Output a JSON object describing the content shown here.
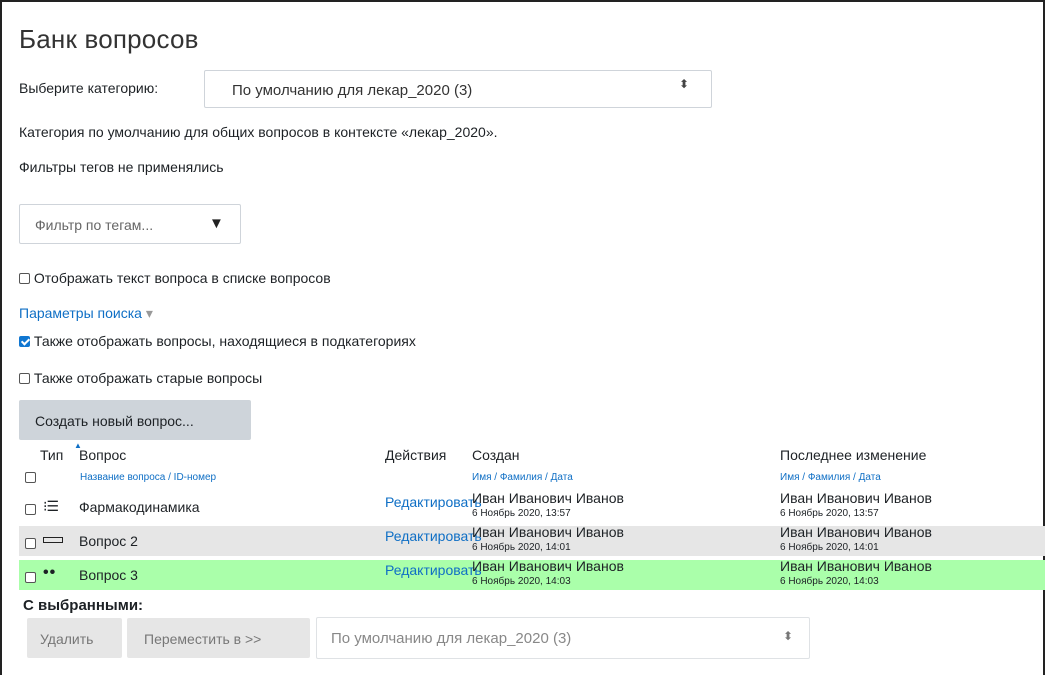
{
  "page_title": "Банк вопросов",
  "category": {
    "label": "Выберите категорию:",
    "selected": "По умолчанию для лекар_2020 (3)",
    "description": "Категория по умолчанию для общих вопросов в контексте «лекар_2020».",
    "arrows": "⬍"
  },
  "tags": {
    "status": "Фильтры тегов не применялись",
    "filter_placeholder": "Фильтр по тегам...",
    "filter_arrow": "▼"
  },
  "options": {
    "show_text": "Отображать текст вопроса в списке вопросов",
    "search_params": "Параметры поиска",
    "search_params_arrow": "▾",
    "subcategories": "Также отображать вопросы, находящиеся в подкатегориях",
    "old_questions": "Также отображать старые вопросы"
  },
  "create_button": "Создать новый вопрос...",
  "table": {
    "col_type": "Тип",
    "col_question": "Вопрос",
    "col_question_sub": "Название вопроса / ID-номер",
    "col_actions": "Действия",
    "col_created": "Создан",
    "col_created_sub": "Имя / Фамилия / Дата",
    "col_modified": "Последнее изменение",
    "col_modified_sub": "Имя / Фамилия / Дата",
    "rows": [
      {
        "type_icon": "multichoice-icon",
        "name": "Фармакодинамика",
        "action": "Редактировать",
        "created_by": "Иван Иванович Иванов",
        "created_at": "6 Ноябрь 2020, 13:57",
        "modified_by": "Иван Иванович Иванов",
        "modified_at": "6 Ноябрь 2020, 13:57"
      },
      {
        "type_icon": "shortanswer-icon",
        "name": "Вопрос 2",
        "action": "Редактировать",
        "created_by": "Иван Иванович Иванов",
        "created_at": "6 Ноябрь 2020, 14:01",
        "modified_by": "Иван Иванович Иванов",
        "modified_at": "6 Ноябрь 2020, 14:01"
      },
      {
        "type_icon": "truefalse-icon",
        "name": "Вопрос 3",
        "action": "Редактировать",
        "created_by": "Иван Иванович Иванов",
        "created_at": "6 Ноябрь 2020, 14:03",
        "modified_by": "Иван Иванович Иванов",
        "modified_at": "6 Ноябрь 2020, 14:03"
      }
    ]
  },
  "bulk": {
    "label": "С выбранными:",
    "delete": "Удалить",
    "move": "Переместить в >>",
    "target": "По умолчанию для лекар_2020 (3)",
    "arrows": "⬍"
  },
  "colors": {
    "row_grey": "#e6e6e6",
    "row_highlight": "#aaffaa",
    "link": "#0f6fc5",
    "checkbox_checked": "#1177d1"
  }
}
